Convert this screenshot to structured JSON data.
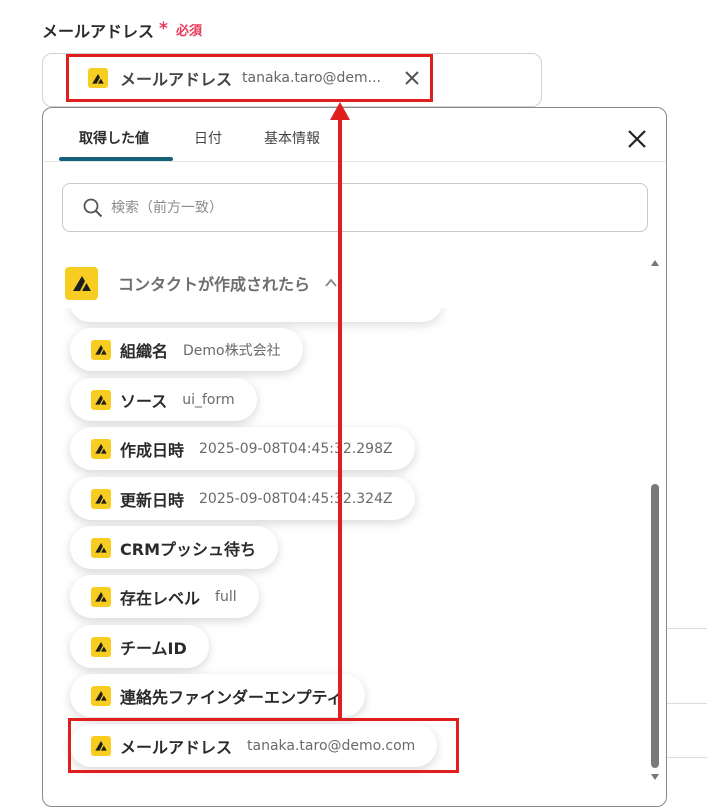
{
  "field": {
    "label": "メールアドレス",
    "required_star": "*",
    "required_text": "必須"
  },
  "selected_chip": {
    "key": "メールアドレス",
    "value": "tanaka.taro@dem...",
    "icon": "app-logo-icon",
    "remove_icon": "close-icon"
  },
  "picker": {
    "tabs": [
      {
        "label": "取得した値",
        "active": true
      },
      {
        "label": "日付",
        "active": false
      },
      {
        "label": "基本情報",
        "active": false
      }
    ],
    "close_icon": "close-icon",
    "search": {
      "placeholder": "検索（前方一致）",
      "value": "",
      "icon": "search-icon"
    },
    "group": {
      "title": "コンタクトが作成されたら",
      "expanded": true,
      "icon": "app-logo-icon",
      "caret_icon": "chevron-up-icon"
    },
    "items": [
      {
        "key": "組織名",
        "value": "Demo株式会社"
      },
      {
        "key": "ソース",
        "value": "ui_form"
      },
      {
        "key": "作成日時",
        "value": "2025-09-08T04:45:32.298Z"
      },
      {
        "key": "更新日時",
        "value": "2025-09-08T04:45:32.324Z"
      },
      {
        "key": "CRMプッシュ待ち",
        "value": ""
      },
      {
        "key": "存在レベル",
        "value": "full"
      },
      {
        "key": "チームID",
        "value": ""
      },
      {
        "key": "連絡先ファインダーエンプティ",
        "value": ""
      },
      {
        "key": "メールアドレス",
        "value": "tanaka.taro@demo.com"
      }
    ]
  },
  "colors": {
    "accent_tab": "#17607a",
    "required": "#e6395a",
    "logo_yellow": "#f7cd21",
    "annotation_red": "#e01e1e"
  }
}
